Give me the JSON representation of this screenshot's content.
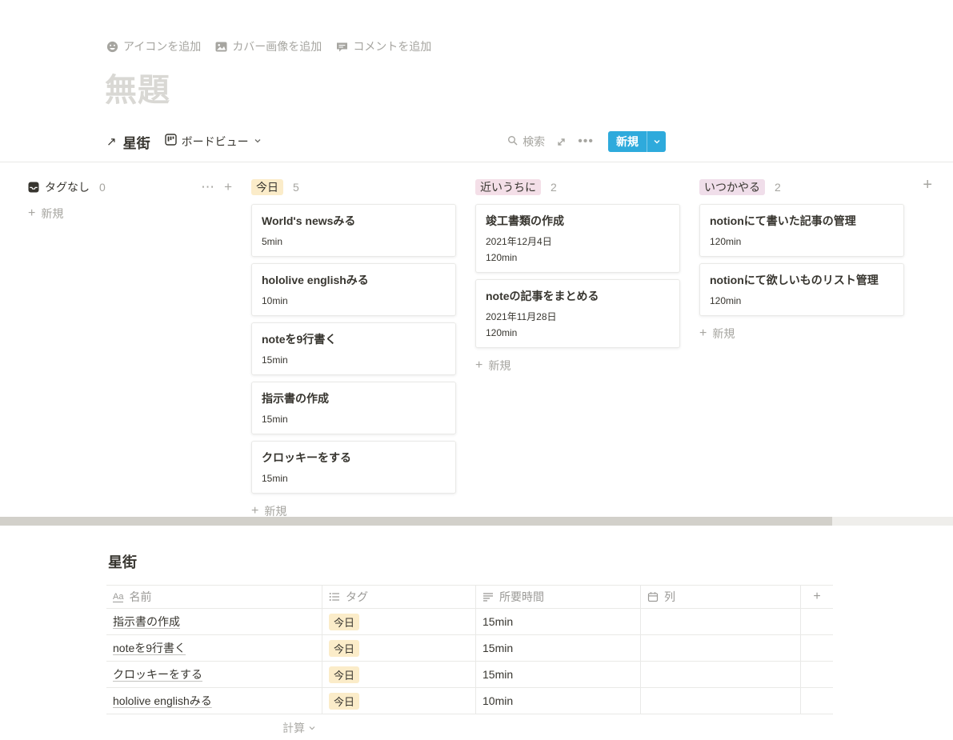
{
  "page": {
    "actions": [
      {
        "icon": "smiley-icon",
        "label": "アイコンを追加"
      },
      {
        "icon": "image-icon",
        "label": "カバー画像を追加"
      },
      {
        "icon": "comment-icon",
        "label": "コメントを追加"
      }
    ],
    "title_placeholder": "無題"
  },
  "view_header": {
    "collection_title": "星街",
    "view_name": "ボードビュー",
    "search_label": "検索",
    "new_button_label": "新規"
  },
  "board": {
    "add_card_label": "新規",
    "columns": [
      {
        "id": "no-tag",
        "name": "タグなし",
        "count": "0",
        "badge_bg": null,
        "icon": "inbox-icon",
        "cards": []
      },
      {
        "id": "today",
        "name": "今日",
        "count": "5",
        "badge_bg": "#FBECC9",
        "cards": [
          {
            "title": "World's newsみる",
            "props": [
              "5min"
            ]
          },
          {
            "title": "hololive englishみる",
            "props": [
              "10min"
            ]
          },
          {
            "title": "noteを9行書く",
            "props": [
              "15min"
            ]
          },
          {
            "title": "指示書の作成",
            "props": [
              "15min"
            ]
          },
          {
            "title": "クロッキーをする",
            "props": [
              "15min"
            ]
          }
        ]
      },
      {
        "id": "soon",
        "name": "近いうちに",
        "count": "2",
        "badge_bg": "#F4DFE8",
        "cards": [
          {
            "title": "竣工書類の作成",
            "props": [
              "2021年12月4日",
              "120min"
            ]
          },
          {
            "title": "noteの記事をまとめる",
            "props": [
              "2021年11月28日",
              "120min"
            ]
          }
        ]
      },
      {
        "id": "someday",
        "name": "いつかやる",
        "count": "2",
        "badge_bg": "#F0DEEA",
        "cards": [
          {
            "title": "notionにて書いた記事の管理",
            "props": [
              "120min"
            ]
          },
          {
            "title": "notionにて欲しいものリスト管理",
            "props": [
              "120min"
            ]
          }
        ]
      }
    ]
  },
  "table": {
    "title": "星街",
    "columns": [
      {
        "icon": "title-icon",
        "label": "名前"
      },
      {
        "icon": "multiselect-icon",
        "label": "タグ"
      },
      {
        "icon": "text-icon",
        "label": "所要時間"
      },
      {
        "icon": "date-icon",
        "label": "列"
      }
    ],
    "rows": [
      {
        "name": "指示書の作成",
        "tag": "今日",
        "time": "15min",
        "col": ""
      },
      {
        "name": "noteを9行書く",
        "tag": "今日",
        "time": "15min",
        "col": ""
      },
      {
        "name": "クロッキーをする",
        "tag": "今日",
        "time": "15min",
        "col": ""
      },
      {
        "name": "hololive englishみる",
        "tag": "今日",
        "time": "10min",
        "col": ""
      }
    ],
    "tag_bg": "#FBECC9",
    "calc_label": "計算"
  },
  "colors": {
    "accent": "#2EAADC",
    "text": "#37352F",
    "muted": "#9B9A97",
    "border": "#E9E9E7",
    "badge_yellow": "#FBECC9",
    "badge_pink": "#F4DFE8",
    "badge_purple_pink": "#F0DEEA",
    "scroll_thumb": "#D2D0CA",
    "scroll_track": "#EFEEEB"
  }
}
